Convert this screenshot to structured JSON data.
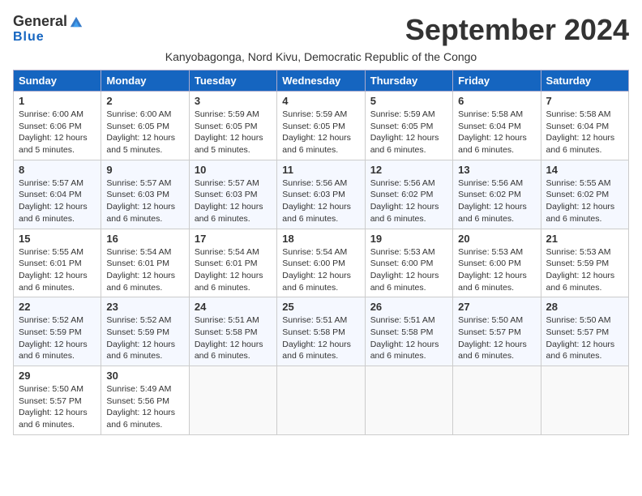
{
  "header": {
    "logo_general": "General",
    "logo_blue": "Blue",
    "month_title": "September 2024",
    "location": "Kanyobagonga, Nord Kivu, Democratic Republic of the Congo"
  },
  "days_of_week": [
    "Sunday",
    "Monday",
    "Tuesday",
    "Wednesday",
    "Thursday",
    "Friday",
    "Saturday"
  ],
  "weeks": [
    [
      {
        "day": "1",
        "sunrise": "Sunrise: 6:00 AM",
        "sunset": "Sunset: 6:06 PM",
        "daylight": "Daylight: 12 hours and 5 minutes."
      },
      {
        "day": "2",
        "sunrise": "Sunrise: 6:00 AM",
        "sunset": "Sunset: 6:05 PM",
        "daylight": "Daylight: 12 hours and 5 minutes."
      },
      {
        "day": "3",
        "sunrise": "Sunrise: 5:59 AM",
        "sunset": "Sunset: 6:05 PM",
        "daylight": "Daylight: 12 hours and 5 minutes."
      },
      {
        "day": "4",
        "sunrise": "Sunrise: 5:59 AM",
        "sunset": "Sunset: 6:05 PM",
        "daylight": "Daylight: 12 hours and 6 minutes."
      },
      {
        "day": "5",
        "sunrise": "Sunrise: 5:59 AM",
        "sunset": "Sunset: 6:05 PM",
        "daylight": "Daylight: 12 hours and 6 minutes."
      },
      {
        "day": "6",
        "sunrise": "Sunrise: 5:58 AM",
        "sunset": "Sunset: 6:04 PM",
        "daylight": "Daylight: 12 hours and 6 minutes."
      },
      {
        "day": "7",
        "sunrise": "Sunrise: 5:58 AM",
        "sunset": "Sunset: 6:04 PM",
        "daylight": "Daylight: 12 hours and 6 minutes."
      }
    ],
    [
      {
        "day": "8",
        "sunrise": "Sunrise: 5:57 AM",
        "sunset": "Sunset: 6:04 PM",
        "daylight": "Daylight: 12 hours and 6 minutes."
      },
      {
        "day": "9",
        "sunrise": "Sunrise: 5:57 AM",
        "sunset": "Sunset: 6:03 PM",
        "daylight": "Daylight: 12 hours and 6 minutes."
      },
      {
        "day": "10",
        "sunrise": "Sunrise: 5:57 AM",
        "sunset": "Sunset: 6:03 PM",
        "daylight": "Daylight: 12 hours and 6 minutes."
      },
      {
        "day": "11",
        "sunrise": "Sunrise: 5:56 AM",
        "sunset": "Sunset: 6:03 PM",
        "daylight": "Daylight: 12 hours and 6 minutes."
      },
      {
        "day": "12",
        "sunrise": "Sunrise: 5:56 AM",
        "sunset": "Sunset: 6:02 PM",
        "daylight": "Daylight: 12 hours and 6 minutes."
      },
      {
        "day": "13",
        "sunrise": "Sunrise: 5:56 AM",
        "sunset": "Sunset: 6:02 PM",
        "daylight": "Daylight: 12 hours and 6 minutes."
      },
      {
        "day": "14",
        "sunrise": "Sunrise: 5:55 AM",
        "sunset": "Sunset: 6:02 PM",
        "daylight": "Daylight: 12 hours and 6 minutes."
      }
    ],
    [
      {
        "day": "15",
        "sunrise": "Sunrise: 5:55 AM",
        "sunset": "Sunset: 6:01 PM",
        "daylight": "Daylight: 12 hours and 6 minutes."
      },
      {
        "day": "16",
        "sunrise": "Sunrise: 5:54 AM",
        "sunset": "Sunset: 6:01 PM",
        "daylight": "Daylight: 12 hours and 6 minutes."
      },
      {
        "day": "17",
        "sunrise": "Sunrise: 5:54 AM",
        "sunset": "Sunset: 6:01 PM",
        "daylight": "Daylight: 12 hours and 6 minutes."
      },
      {
        "day": "18",
        "sunrise": "Sunrise: 5:54 AM",
        "sunset": "Sunset: 6:00 PM",
        "daylight": "Daylight: 12 hours and 6 minutes."
      },
      {
        "day": "19",
        "sunrise": "Sunrise: 5:53 AM",
        "sunset": "Sunset: 6:00 PM",
        "daylight": "Daylight: 12 hours and 6 minutes."
      },
      {
        "day": "20",
        "sunrise": "Sunrise: 5:53 AM",
        "sunset": "Sunset: 6:00 PM",
        "daylight": "Daylight: 12 hours and 6 minutes."
      },
      {
        "day": "21",
        "sunrise": "Sunrise: 5:53 AM",
        "sunset": "Sunset: 5:59 PM",
        "daylight": "Daylight: 12 hours and 6 minutes."
      }
    ],
    [
      {
        "day": "22",
        "sunrise": "Sunrise: 5:52 AM",
        "sunset": "Sunset: 5:59 PM",
        "daylight": "Daylight: 12 hours and 6 minutes."
      },
      {
        "day": "23",
        "sunrise": "Sunrise: 5:52 AM",
        "sunset": "Sunset: 5:59 PM",
        "daylight": "Daylight: 12 hours and 6 minutes."
      },
      {
        "day": "24",
        "sunrise": "Sunrise: 5:51 AM",
        "sunset": "Sunset: 5:58 PM",
        "daylight": "Daylight: 12 hours and 6 minutes."
      },
      {
        "day": "25",
        "sunrise": "Sunrise: 5:51 AM",
        "sunset": "Sunset: 5:58 PM",
        "daylight": "Daylight: 12 hours and 6 minutes."
      },
      {
        "day": "26",
        "sunrise": "Sunrise: 5:51 AM",
        "sunset": "Sunset: 5:58 PM",
        "daylight": "Daylight: 12 hours and 6 minutes."
      },
      {
        "day": "27",
        "sunrise": "Sunrise: 5:50 AM",
        "sunset": "Sunset: 5:57 PM",
        "daylight": "Daylight: 12 hours and 6 minutes."
      },
      {
        "day": "28",
        "sunrise": "Sunrise: 5:50 AM",
        "sunset": "Sunset: 5:57 PM",
        "daylight": "Daylight: 12 hours and 6 minutes."
      }
    ],
    [
      {
        "day": "29",
        "sunrise": "Sunrise: 5:50 AM",
        "sunset": "Sunset: 5:57 PM",
        "daylight": "Daylight: 12 hours and 6 minutes."
      },
      {
        "day": "30",
        "sunrise": "Sunrise: 5:49 AM",
        "sunset": "Sunset: 5:56 PM",
        "daylight": "Daylight: 12 hours and 6 minutes."
      },
      null,
      null,
      null,
      null,
      null
    ]
  ]
}
